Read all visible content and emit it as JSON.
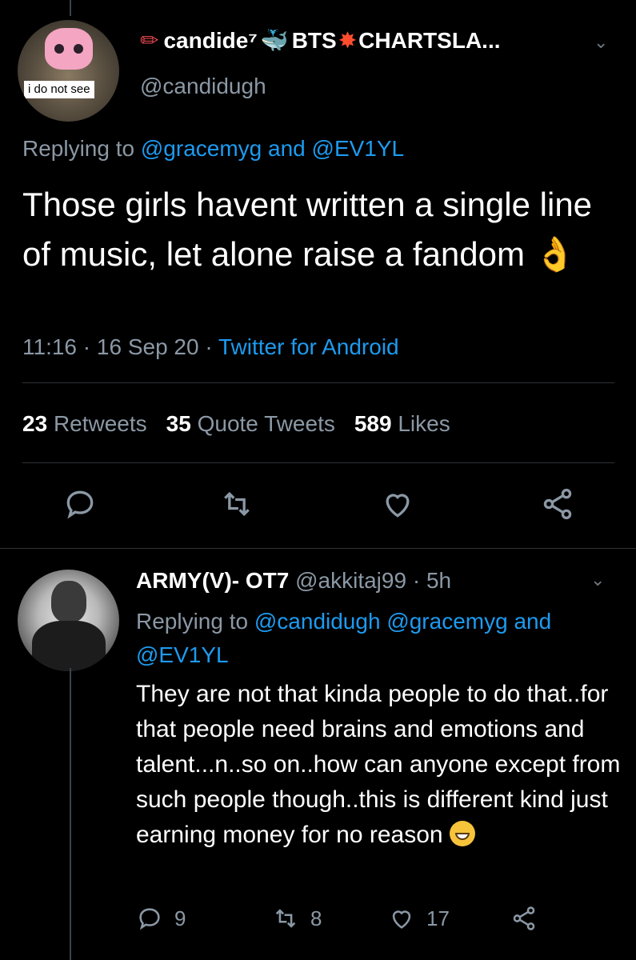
{
  "tweet": {
    "avatar_caption": "i do not see",
    "display_name": "candide⁷",
    "display_name_suffix": "BTS",
    "display_name_tail": "CHARTSLA...",
    "handle": "@candidugh",
    "replying_prefix": "Replying to",
    "replying_to_1": "@gracemyg",
    "replying_and": "and",
    "replying_to_2": "@EV1YL",
    "text": "Those girls havent written a single line of music, let alone raise a fandom",
    "time": "11:16",
    "date": "16 Sep 20",
    "source": "Twitter for Android",
    "retweets_count": "23",
    "retweets_label": "Retweets",
    "quotes_count": "35",
    "quotes_label": "Quote Tweets",
    "likes_count": "589",
    "likes_label": "Likes"
  },
  "reply": {
    "display_name": "ARMY(V)- OT7",
    "handle": "@akkitaj99",
    "age": "5h",
    "replying_prefix": "Replying to",
    "replying_to_1": "@candidugh",
    "replying_to_2": "@gracemyg",
    "replying_and": "and",
    "replying_to_3": "@EV1YL",
    "text": "They are not that kinda people to do that..for that people need brains and emotions and talent...n..so on..how can anyone except from such people though..this is different kind just earning money for no reason",
    "reply_count": "9",
    "retweet_count": "8",
    "like_count": "17"
  },
  "colors": {
    "background": "#000000",
    "link": "#1d9bf0",
    "muted": "#8b98a5",
    "text": "#ffffff"
  }
}
